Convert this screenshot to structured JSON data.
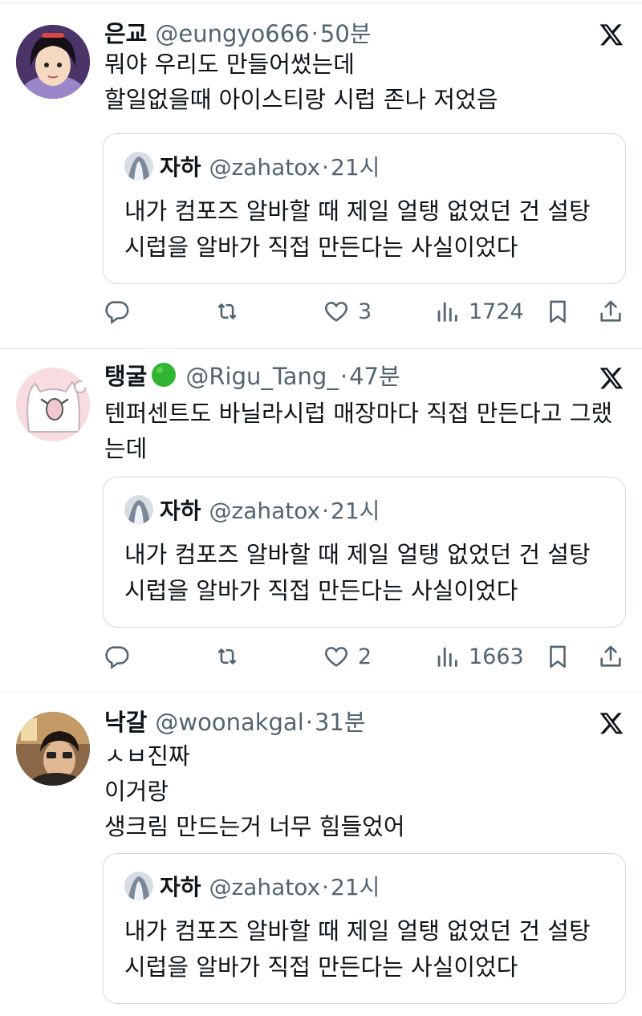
{
  "tweets": [
    {
      "name": "은교",
      "handle": "@eungyo666",
      "dot": "·",
      "time": "50분",
      "lines": [
        "뭐야 우리도 만들어썼는데",
        "할일없을때 아이스티랑 시럽 존나 저었음"
      ],
      "quote": {
        "name": "자하",
        "handle": "@zahatox",
        "dot": "·",
        "time": "21시",
        "lines": [
          "내가 컴포즈 알바할 때 제일 얼탱 없었던 건 설탕",
          "시럽을 알바가 직접 만든다는 사실이었다"
        ]
      },
      "likes": "3",
      "views": "1724"
    },
    {
      "name": "탱굴",
      "name_emoji": "green-circle",
      "handle": "@Rigu_Tang_",
      "dot": "·",
      "time": "47분",
      "lines": [
        "텐퍼센트도 바닐라시럽 매장마다 직접 만든다고 그랬",
        "는데"
      ],
      "quote": {
        "name": "자하",
        "handle": "@zahatox",
        "dot": "·",
        "time": "21시",
        "lines": [
          "내가 컴포즈 알바할 때 제일 얼탱 없었던 건 설탕",
          "시럽을 알바가 직접 만든다는 사실이었다"
        ]
      },
      "likes": "2",
      "views": "1663"
    },
    {
      "name": "낙갈",
      "handle": "@woonakgal",
      "dot": "·",
      "time": "31분",
      "lines": [
        "ㅅㅂ진짜",
        "이거랑",
        "생크림 만드는거 너무 힘들었어"
      ],
      "quote": {
        "name": "자하",
        "handle": "@zahatox",
        "dot": "·",
        "time": "21시",
        "lines": [
          "내가 컴포즈 알바할 때 제일 얼탱 없었던 건 설탕",
          "시럽을 알바가 직접 만든다는 사실이었다"
        ]
      }
    }
  ],
  "colors": {
    "text": "#0f1419",
    "secondary": "#536471",
    "border": "#cfd9de",
    "accent_green": "#2fb52f"
  },
  "icons": [
    "x-logo-icon",
    "reply-icon",
    "retweet-icon",
    "like-icon",
    "views-icon",
    "bookmark-icon",
    "share-icon"
  ]
}
